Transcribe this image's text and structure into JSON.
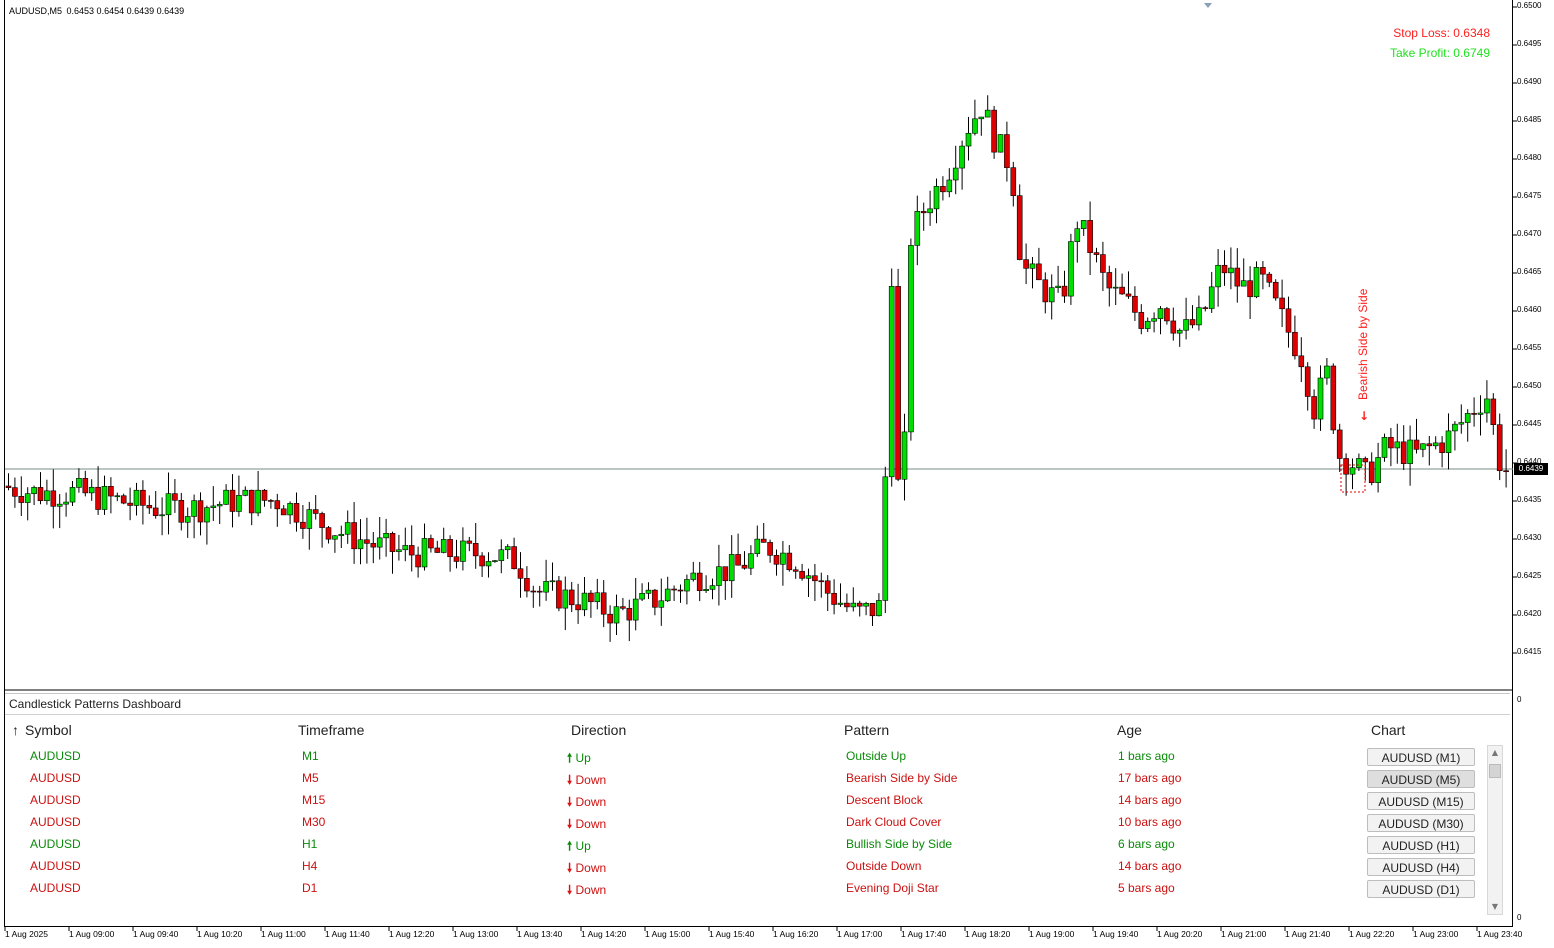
{
  "header": {
    "symbol": "AUDUSD,M5",
    "ohlc": "0.6453 0.6454 0.6439 0.6439"
  },
  "risk": {
    "stop_loss": "Stop Loss: 0.6348",
    "take_profit": "Take Profit: 0.6749"
  },
  "price_axis": [
    "0.6500",
    "0.6495",
    "0.6490",
    "0.6485",
    "0.6480",
    "0.6475",
    "0.6470",
    "0.6465",
    "0.6460",
    "0.6455",
    "0.6450",
    "0.6445",
    "0.6440",
    "0.6435",
    "0.6430",
    "0.6425",
    "0.6420",
    "0.6415"
  ],
  "current_price": "0.6439",
  "time_axis": [
    "1 Aug 2025",
    "1 Aug 09:00",
    "1 Aug 09:40",
    "1 Aug 10:20",
    "1 Aug 11:00",
    "1 Aug 11:40",
    "1 Aug 12:20",
    "1 Aug 13:00",
    "1 Aug 13:40",
    "1 Aug 14:20",
    "1 Aug 15:00",
    "1 Aug 15:40",
    "1 Aug 16:20",
    "1 Aug 17:00",
    "1 Aug 17:40",
    "1 Aug 18:20",
    "1 Aug 19:00",
    "1 Aug 19:40",
    "1 Aug 20:20",
    "1 Aug 21:00",
    "1 Aug 21:40",
    "1 Aug 22:20",
    "1 Aug 23:00",
    "1 Aug 23:40"
  ],
  "indicator_axis": [
    "0"
  ],
  "pattern_label": "Bearish Side by Side",
  "colors": {
    "bull": "#00dd00",
    "bear": "#dd0000",
    "up_text": "#0a8a0a",
    "down_text": "#cc1111"
  },
  "dashboard": {
    "title": "Candlestick Patterns Dashboard",
    "sort_icon": "arrow-up-icon",
    "columns": [
      "Symbol",
      "Timeframe",
      "Direction",
      "Pattern",
      "Age",
      "Chart"
    ],
    "rows": [
      {
        "symbol": "AUDUSD",
        "timeframe": "M1",
        "direction": "Up",
        "pattern": "Outside Up",
        "age": "1 bars ago",
        "chart": "AUDUSD (M1)",
        "dir": "up"
      },
      {
        "symbol": "AUDUSD",
        "timeframe": "M5",
        "direction": "Down",
        "pattern": "Bearish Side by Side",
        "age": "17 bars ago",
        "chart": "AUDUSD (M5)",
        "dir": "down"
      },
      {
        "symbol": "AUDUSD",
        "timeframe": "M15",
        "direction": "Down",
        "pattern": "Descent Block",
        "age": "14 bars ago",
        "chart": "AUDUSD (M15)",
        "dir": "down"
      },
      {
        "symbol": "AUDUSD",
        "timeframe": "M30",
        "direction": "Down",
        "pattern": "Dark Cloud Cover",
        "age": "10 bars ago",
        "chart": "AUDUSD (M30)",
        "dir": "down"
      },
      {
        "symbol": "AUDUSD",
        "timeframe": "H1",
        "direction": "Up",
        "pattern": "Bullish Side by Side",
        "age": "6 bars ago",
        "chart": "AUDUSD (H1)",
        "dir": "up"
      },
      {
        "symbol": "AUDUSD",
        "timeframe": "H4",
        "direction": "Down",
        "pattern": "Outside Down",
        "age": "14 bars ago",
        "chart": "AUDUSD (H4)",
        "dir": "down"
      },
      {
        "symbol": "AUDUSD",
        "timeframe": "D1",
        "direction": "Down",
        "pattern": "Evening Doji Star",
        "age": "5 bars ago",
        "chart": "AUDUSD (D1)",
        "dir": "down"
      }
    ]
  }
}
